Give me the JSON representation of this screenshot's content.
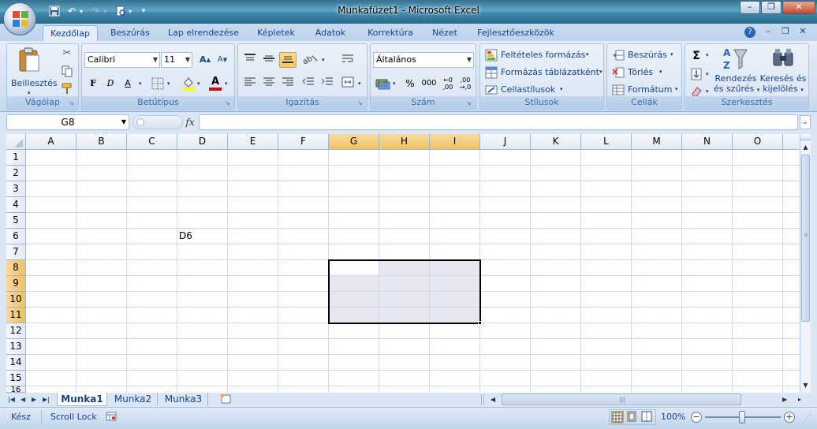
{
  "window": {
    "title": "Munkafüzet1 - Microsoft Excel"
  },
  "qat": {
    "icons": [
      "save-icon",
      "undo-icon",
      "redo-icon",
      "print-preview-icon",
      "customize-qat-icon"
    ]
  },
  "tabs": [
    "Kezdőlap",
    "Beszúrás",
    "Lap elrendezése",
    "Képletek",
    "Adatok",
    "Korrektúra",
    "Nézet",
    "Fejlesztőeszközök"
  ],
  "ribbon": {
    "clipboard": {
      "label": "Vágólap",
      "paste_label": "Beillesztés"
    },
    "font": {
      "label": "Betűtípus",
      "font_name": "Calibri",
      "font_size": "11",
      "bold": "F",
      "italic": "D",
      "underline": "A",
      "font_color_glyph": "A"
    },
    "alignment": {
      "label": "Igazítás"
    },
    "number": {
      "label": "Szám",
      "format": "Általános",
      "percent": "%",
      "thousands": "000"
    },
    "styles": {
      "label": "Stílusok",
      "conditional": "Feltételes formázás",
      "format_table": "Formázás táblázatként",
      "cell_styles": "Cellastílusok"
    },
    "cells": {
      "label": "Cellák",
      "insert": "Beszúrás",
      "delete": "Törlés",
      "format": "Formátum"
    },
    "editing": {
      "label": "Szerkesztés",
      "sigma": "Σ",
      "sort_line1": "Rendezés",
      "sort_line2": "és szűrés",
      "find_line1": "Keresés és",
      "find_line2": "kijelölés"
    }
  },
  "formula_bar": {
    "name_box": "G8",
    "fx": "fx",
    "value": ""
  },
  "grid": {
    "columns": [
      "A",
      "B",
      "C",
      "D",
      "E",
      "F",
      "G",
      "H",
      "I",
      "J",
      "K",
      "L",
      "M",
      "N",
      "O"
    ],
    "rows": [
      "1",
      "2",
      "3",
      "4",
      "5",
      "6",
      "7",
      "8",
      "9",
      "10",
      "11",
      "12",
      "13",
      "14",
      "15",
      "16"
    ],
    "selected_columns": [
      "G",
      "H",
      "I"
    ],
    "selected_rows": [
      "8",
      "9",
      "10",
      "11"
    ],
    "cells": {
      "D6": "D6"
    },
    "selection": "G8:I11",
    "active_cell": "G8"
  },
  "sheets": [
    "Munka1",
    "Munka2",
    "Munka3"
  ],
  "active_sheet": "Munka1",
  "status": {
    "ready": "Kész",
    "scroll_lock": "Scroll Lock",
    "zoom": "100%"
  },
  "colors": {
    "selection_fill": "#e6e6f0",
    "header_highlight": "#f4c76c",
    "ribbon_bg": "#dbe6f4"
  }
}
